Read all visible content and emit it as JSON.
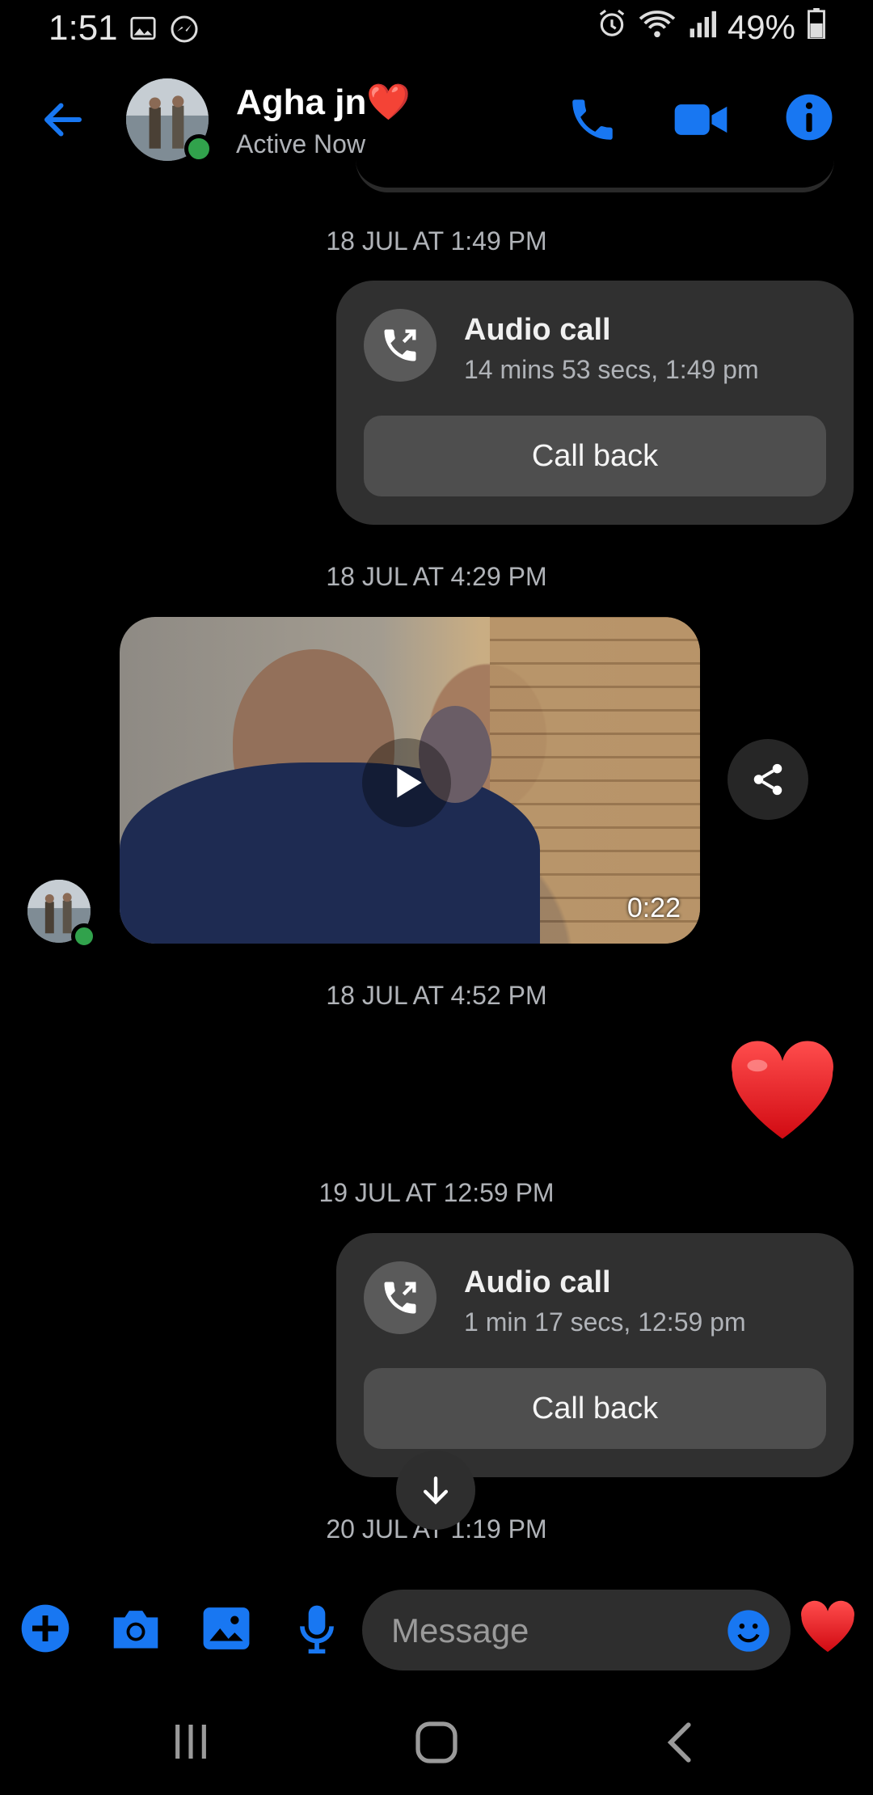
{
  "status_bar": {
    "time": "1:51",
    "battery": "49%"
  },
  "header": {
    "contact_name": "Agha jn",
    "name_emoji": "❤️",
    "active_status": "Active Now",
    "icons": [
      "back-arrow-icon",
      "phone-icon",
      "video-camera-icon",
      "info-icon"
    ]
  },
  "conversation": {
    "timestamps": [
      "18 JUL AT 1:49 PM",
      "18 JUL AT 4:29 PM",
      "18 JUL AT 4:52 PM",
      "19 JUL AT 12:59 PM",
      "20 JUL AT 1:19 PM"
    ],
    "calls": [
      {
        "title": "Audio call",
        "detail": "14 mins 53 secs, 1:49 pm",
        "button": "Call back"
      },
      {
        "title": "Audio call",
        "detail": "1 min 17 secs, 12:59 pm",
        "button": "Call back"
      }
    ],
    "video": {
      "duration": "0:22"
    },
    "reaction": "❤️"
  },
  "composer": {
    "placeholder": "Message",
    "like_emoji": "❤️"
  },
  "colors": {
    "accent": "#1877f2",
    "background": "#000000",
    "bubble": "#303030",
    "online": "#31a24c"
  }
}
